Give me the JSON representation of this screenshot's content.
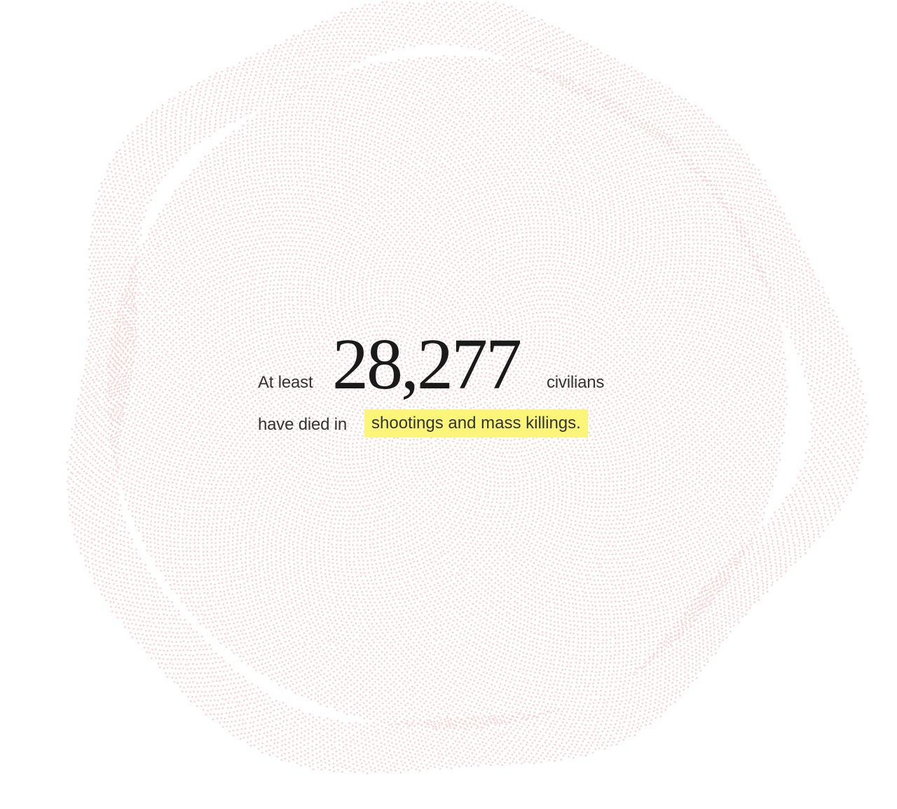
{
  "chart_data": {
    "type": "scatter",
    "title": "",
    "xlabel": "",
    "ylabel": "",
    "encoding": "unit dot cloud, one dot per civilian death",
    "total_dots": 28277,
    "dot_color": "#f2c9cb",
    "series": [
      {
        "values": [
          28277
        ]
      }
    ]
  },
  "headline": {
    "lead": "At least",
    "count": "28,277",
    "noun": "civilians",
    "verb": "have died in",
    "highlight": "shootings and mass killings."
  },
  "colors": {
    "highlight_bg": "#fbf57a",
    "text": "#333333",
    "count_text": "#1a1a1a"
  }
}
